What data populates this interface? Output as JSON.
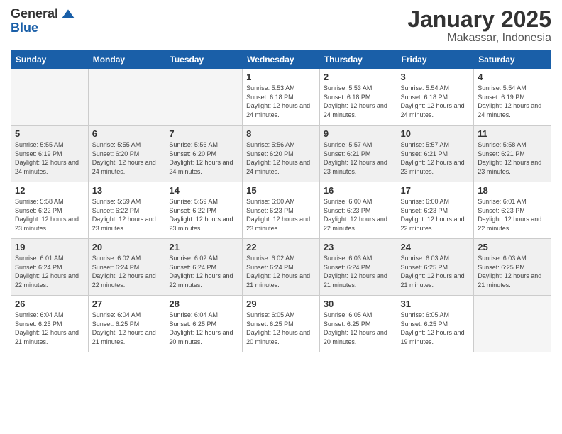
{
  "header": {
    "logo_general": "General",
    "logo_blue": "Blue",
    "title": "January 2025",
    "subtitle": "Makassar, Indonesia"
  },
  "weekdays": [
    "Sunday",
    "Monday",
    "Tuesday",
    "Wednesday",
    "Thursday",
    "Friday",
    "Saturday"
  ],
  "weeks": [
    [
      {
        "day": "",
        "sunrise": "",
        "sunset": "",
        "daylight": "",
        "empty": true
      },
      {
        "day": "",
        "sunrise": "",
        "sunset": "",
        "daylight": "",
        "empty": true
      },
      {
        "day": "",
        "sunrise": "",
        "sunset": "",
        "daylight": "",
        "empty": true
      },
      {
        "day": "1",
        "sunrise": "Sunrise: 5:53 AM",
        "sunset": "Sunset: 6:18 PM",
        "daylight": "Daylight: 12 hours and 24 minutes.",
        "empty": false
      },
      {
        "day": "2",
        "sunrise": "Sunrise: 5:53 AM",
        "sunset": "Sunset: 6:18 PM",
        "daylight": "Daylight: 12 hours and 24 minutes.",
        "empty": false
      },
      {
        "day": "3",
        "sunrise": "Sunrise: 5:54 AM",
        "sunset": "Sunset: 6:18 PM",
        "daylight": "Daylight: 12 hours and 24 minutes.",
        "empty": false
      },
      {
        "day": "4",
        "sunrise": "Sunrise: 5:54 AM",
        "sunset": "Sunset: 6:19 PM",
        "daylight": "Daylight: 12 hours and 24 minutes.",
        "empty": false
      }
    ],
    [
      {
        "day": "5",
        "sunrise": "Sunrise: 5:55 AM",
        "sunset": "Sunset: 6:19 PM",
        "daylight": "Daylight: 12 hours and 24 minutes.",
        "empty": false
      },
      {
        "day": "6",
        "sunrise": "Sunrise: 5:55 AM",
        "sunset": "Sunset: 6:20 PM",
        "daylight": "Daylight: 12 hours and 24 minutes.",
        "empty": false
      },
      {
        "day": "7",
        "sunrise": "Sunrise: 5:56 AM",
        "sunset": "Sunset: 6:20 PM",
        "daylight": "Daylight: 12 hours and 24 minutes.",
        "empty": false
      },
      {
        "day": "8",
        "sunrise": "Sunrise: 5:56 AM",
        "sunset": "Sunset: 6:20 PM",
        "daylight": "Daylight: 12 hours and 24 minutes.",
        "empty": false
      },
      {
        "day": "9",
        "sunrise": "Sunrise: 5:57 AM",
        "sunset": "Sunset: 6:21 PM",
        "daylight": "Daylight: 12 hours and 23 minutes.",
        "empty": false
      },
      {
        "day": "10",
        "sunrise": "Sunrise: 5:57 AM",
        "sunset": "Sunset: 6:21 PM",
        "daylight": "Daylight: 12 hours and 23 minutes.",
        "empty": false
      },
      {
        "day": "11",
        "sunrise": "Sunrise: 5:58 AM",
        "sunset": "Sunset: 6:21 PM",
        "daylight": "Daylight: 12 hours and 23 minutes.",
        "empty": false
      }
    ],
    [
      {
        "day": "12",
        "sunrise": "Sunrise: 5:58 AM",
        "sunset": "Sunset: 6:22 PM",
        "daylight": "Daylight: 12 hours and 23 minutes.",
        "empty": false
      },
      {
        "day": "13",
        "sunrise": "Sunrise: 5:59 AM",
        "sunset": "Sunset: 6:22 PM",
        "daylight": "Daylight: 12 hours and 23 minutes.",
        "empty": false
      },
      {
        "day": "14",
        "sunrise": "Sunrise: 5:59 AM",
        "sunset": "Sunset: 6:22 PM",
        "daylight": "Daylight: 12 hours and 23 minutes.",
        "empty": false
      },
      {
        "day": "15",
        "sunrise": "Sunrise: 6:00 AM",
        "sunset": "Sunset: 6:23 PM",
        "daylight": "Daylight: 12 hours and 23 minutes.",
        "empty": false
      },
      {
        "day": "16",
        "sunrise": "Sunrise: 6:00 AM",
        "sunset": "Sunset: 6:23 PM",
        "daylight": "Daylight: 12 hours and 22 minutes.",
        "empty": false
      },
      {
        "day": "17",
        "sunrise": "Sunrise: 6:00 AM",
        "sunset": "Sunset: 6:23 PM",
        "daylight": "Daylight: 12 hours and 22 minutes.",
        "empty": false
      },
      {
        "day": "18",
        "sunrise": "Sunrise: 6:01 AM",
        "sunset": "Sunset: 6:23 PM",
        "daylight": "Daylight: 12 hours and 22 minutes.",
        "empty": false
      }
    ],
    [
      {
        "day": "19",
        "sunrise": "Sunrise: 6:01 AM",
        "sunset": "Sunset: 6:24 PM",
        "daylight": "Daylight: 12 hours and 22 minutes.",
        "empty": false
      },
      {
        "day": "20",
        "sunrise": "Sunrise: 6:02 AM",
        "sunset": "Sunset: 6:24 PM",
        "daylight": "Daylight: 12 hours and 22 minutes.",
        "empty": false
      },
      {
        "day": "21",
        "sunrise": "Sunrise: 6:02 AM",
        "sunset": "Sunset: 6:24 PM",
        "daylight": "Daylight: 12 hours and 22 minutes.",
        "empty": false
      },
      {
        "day": "22",
        "sunrise": "Sunrise: 6:02 AM",
        "sunset": "Sunset: 6:24 PM",
        "daylight": "Daylight: 12 hours and 21 minutes.",
        "empty": false
      },
      {
        "day": "23",
        "sunrise": "Sunrise: 6:03 AM",
        "sunset": "Sunset: 6:24 PM",
        "daylight": "Daylight: 12 hours and 21 minutes.",
        "empty": false
      },
      {
        "day": "24",
        "sunrise": "Sunrise: 6:03 AM",
        "sunset": "Sunset: 6:25 PM",
        "daylight": "Daylight: 12 hours and 21 minutes.",
        "empty": false
      },
      {
        "day": "25",
        "sunrise": "Sunrise: 6:03 AM",
        "sunset": "Sunset: 6:25 PM",
        "daylight": "Daylight: 12 hours and 21 minutes.",
        "empty": false
      }
    ],
    [
      {
        "day": "26",
        "sunrise": "Sunrise: 6:04 AM",
        "sunset": "Sunset: 6:25 PM",
        "daylight": "Daylight: 12 hours and 21 minutes.",
        "empty": false
      },
      {
        "day": "27",
        "sunrise": "Sunrise: 6:04 AM",
        "sunset": "Sunset: 6:25 PM",
        "daylight": "Daylight: 12 hours and 21 minutes.",
        "empty": false
      },
      {
        "day": "28",
        "sunrise": "Sunrise: 6:04 AM",
        "sunset": "Sunset: 6:25 PM",
        "daylight": "Daylight: 12 hours and 20 minutes.",
        "empty": false
      },
      {
        "day": "29",
        "sunrise": "Sunrise: 6:05 AM",
        "sunset": "Sunset: 6:25 PM",
        "daylight": "Daylight: 12 hours and 20 minutes.",
        "empty": false
      },
      {
        "day": "30",
        "sunrise": "Sunrise: 6:05 AM",
        "sunset": "Sunset: 6:25 PM",
        "daylight": "Daylight: 12 hours and 20 minutes.",
        "empty": false
      },
      {
        "day": "31",
        "sunrise": "Sunrise: 6:05 AM",
        "sunset": "Sunset: 6:25 PM",
        "daylight": "Daylight: 12 hours and 19 minutes.",
        "empty": false
      },
      {
        "day": "",
        "sunrise": "",
        "sunset": "",
        "daylight": "",
        "empty": true
      }
    ]
  ]
}
